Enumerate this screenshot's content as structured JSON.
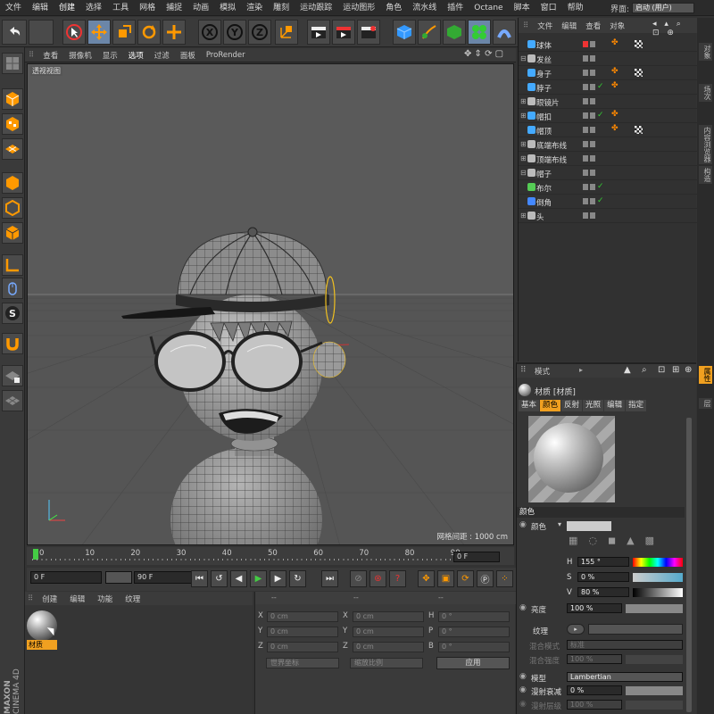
{
  "menu": [
    "文件",
    "编辑",
    "创建",
    "选择",
    "工具",
    "网格",
    "捕捉",
    "动画",
    "模拟",
    "渲染",
    "雕刻",
    "运动跟踪",
    "运动图形",
    "角色",
    "流水线",
    "插件",
    "Octane",
    "脚本",
    "窗口",
    "帮助"
  ],
  "layout": {
    "label": "界面:",
    "value": "启动 (用户)"
  },
  "viewport_menu": [
    "查看",
    "摄像机",
    "显示",
    "选项",
    "过滤",
    "面板",
    "ProRender"
  ],
  "viewport": {
    "title": "透视视图",
    "grid": "网格间距 : 1000 cm"
  },
  "timeline": {
    "ticks": [
      "0",
      "10",
      "20",
      "30",
      "40",
      "50",
      "60",
      "70",
      "80",
      "90"
    ],
    "current": "0 F"
  },
  "transport": {
    "start": "0 F",
    "end": "90 F"
  },
  "materials": {
    "menu": [
      "创建",
      "编辑",
      "功能",
      "纹理"
    ],
    "item": "材质"
  },
  "coords": {
    "header": [
      "--",
      "--",
      "--"
    ],
    "rows": [
      {
        "a": "X",
        "av": "0 cm",
        "b": "X",
        "bv": "0 cm",
        "c": "H",
        "cv": "0 °"
      },
      {
        "a": "Y",
        "av": "0 cm",
        "b": "Y",
        "bv": "0 cm",
        "c": "P",
        "cv": "0 °"
      },
      {
        "a": "Z",
        "av": "0 cm",
        "b": "Z",
        "bv": "0 cm",
        "c": "B",
        "cv": "0 °"
      }
    ],
    "world": "世界坐标",
    "scale": "缩放比例",
    "apply": "应用"
  },
  "objects": {
    "menu": [
      "文件",
      "编辑",
      "查看",
      "对象"
    ],
    "rows": [
      {
        "name": "球体",
        "tree": "",
        "icon": "#4af",
        "vis": "#e33",
        "chk": false,
        "tags": [
          "#f80",
          "checker"
        ]
      },
      {
        "name": "发丝",
        "tree": "⊟",
        "icon": "#bbb",
        "vis": "#888",
        "chk": false,
        "tags": []
      },
      {
        "name": "身子",
        "tree": "",
        "icon": "#4af",
        "vis": "#888",
        "chk": false,
        "tags": [
          "#f80",
          "checker"
        ]
      },
      {
        "name": "脖子",
        "tree": "",
        "icon": "#4af",
        "vis": "#888",
        "chk": true,
        "tags": [
          "#f80"
        ]
      },
      {
        "name": "眼镜片",
        "tree": "⊞",
        "icon": "#bbb",
        "vis": "#888",
        "chk": false,
        "tags": []
      },
      {
        "name": "帽扣",
        "tree": "⊞",
        "icon": "#4af",
        "vis": "#888",
        "chk": true,
        "tags": [
          "#f80"
        ]
      },
      {
        "name": "帽顶",
        "tree": "",
        "icon": "#4af",
        "vis": "#888",
        "chk": false,
        "tags": [
          "#f80",
          "checker"
        ]
      },
      {
        "name": "底端布线",
        "tree": "⊞",
        "icon": "#bbb",
        "vis": "#888",
        "chk": false,
        "tags": []
      },
      {
        "name": "顶端布线",
        "tree": "⊞",
        "icon": "#bbb",
        "vis": "#888",
        "chk": false,
        "tags": []
      },
      {
        "name": "帽子",
        "tree": "⊟",
        "icon": "#bbb",
        "vis": "#888",
        "chk": false,
        "tags": []
      },
      {
        "name": "布尔",
        "tree": "",
        "icon": "#5c5",
        "vis": "#888",
        "chk": true,
        "tags": []
      },
      {
        "name": "倒角",
        "tree": "",
        "icon": "#48f",
        "vis": "#888",
        "chk": true,
        "tags": []
      },
      {
        "name": "头",
        "tree": "⊞",
        "icon": "#bbb",
        "vis": "#888",
        "chk": false,
        "tags": []
      }
    ]
  },
  "attributes": {
    "header": "模式",
    "title": "材质 [材质]",
    "tabs": [
      "基本",
      "颜色",
      "反射",
      "光照",
      "编辑",
      "指定"
    ],
    "selected_tab": "颜色",
    "section": "颜色",
    "color_label": "颜色",
    "h": {
      "label": "H",
      "value": "155 °"
    },
    "s": {
      "label": "S",
      "value": "0 %"
    },
    "v": {
      "label": "V",
      "value": "80 %"
    },
    "brightness": {
      "label": "亮度",
      "value": "100 %"
    },
    "texture": "纹理",
    "blend_mode": {
      "label": "混合模式",
      "value": "标准"
    },
    "blend_strength": {
      "label": "混合强度",
      "value": "100 %"
    },
    "model": {
      "label": "模型",
      "value": "Lambertian"
    },
    "diffuse_falloff": {
      "label": "漫射衰减",
      "value": "0 %"
    },
    "diffuse_level": {
      "label": "漫射层级",
      "value": "100 %"
    }
  },
  "side_tabs": [
    "对象",
    "场次",
    "内容浏览器",
    "构造"
  ],
  "attr_side_tabs": [
    "属性",
    "层"
  ],
  "brand": {
    "line1": "MAXON",
    "line2": "CINEMA 4D"
  }
}
